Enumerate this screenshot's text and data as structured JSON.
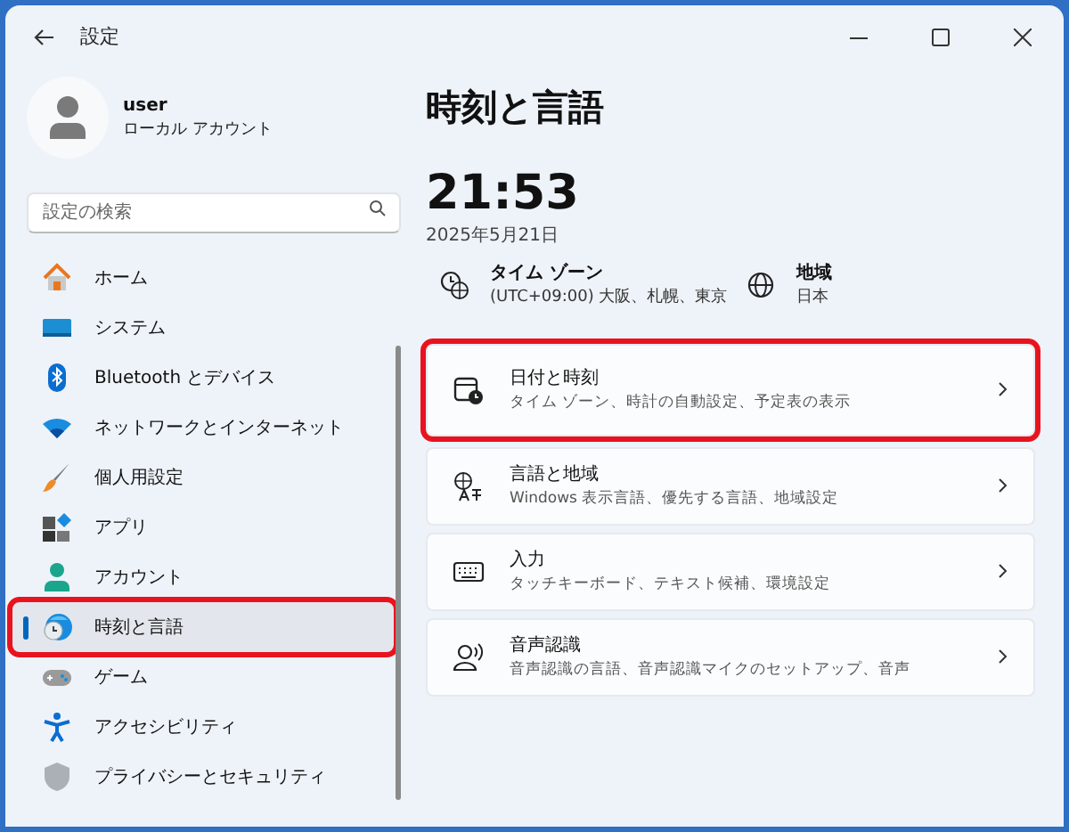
{
  "window": {
    "title": "設定"
  },
  "user": {
    "name": "user",
    "account": "ローカル アカウント"
  },
  "search": {
    "placeholder": "設定の検索"
  },
  "nav": [
    {
      "kind": "home",
      "label": "ホーム",
      "selected": false,
      "highlighted": false
    },
    {
      "kind": "system",
      "label": "システム",
      "selected": false,
      "highlighted": false
    },
    {
      "kind": "bluetooth",
      "label": "Bluetooth とデバイス",
      "selected": false,
      "highlighted": false
    },
    {
      "kind": "network",
      "label": "ネットワークとインターネット",
      "selected": false,
      "highlighted": false
    },
    {
      "kind": "brush",
      "label": "個人用設定",
      "selected": false,
      "highlighted": false
    },
    {
      "kind": "apps",
      "label": "アプリ",
      "selected": false,
      "highlighted": false
    },
    {
      "kind": "account",
      "label": "アカウント",
      "selected": false,
      "highlighted": false
    },
    {
      "kind": "time",
      "label": "時刻と言語",
      "selected": true,
      "highlighted": true
    },
    {
      "kind": "game",
      "label": "ゲーム",
      "selected": false,
      "highlighted": false
    },
    {
      "kind": "access",
      "label": "アクセシビリティ",
      "selected": false,
      "highlighted": false
    },
    {
      "kind": "privacy",
      "label": "プライバシーとセキュリティ",
      "selected": false,
      "highlighted": false
    }
  ],
  "page": {
    "title": "時刻と言語",
    "time": "21:53",
    "date": "2025年5月21日",
    "info": [
      {
        "kind": "timezone",
        "label": "タイム ゾーン",
        "value": "(UTC+09:00) 大阪、札幌、東京"
      },
      {
        "kind": "region",
        "label": "地域",
        "value": "日本"
      }
    ],
    "cards": [
      {
        "kind": "datetime",
        "title": "日付と時刻",
        "subtitle": "タイム ゾーン、時計の自動設定、予定表の表示",
        "highlighted": true
      },
      {
        "kind": "language",
        "title": "言語と地域",
        "subtitle": "Windows 表示言語、優先する言語、地域設定",
        "highlighted": false
      },
      {
        "kind": "typing",
        "title": "入力",
        "subtitle": "タッチキーボード、テキスト候補、環境設定",
        "highlighted": false
      },
      {
        "kind": "speech",
        "title": "音声認識",
        "subtitle": "音声認識の言語、音声認識マイクのセットアップ、音声",
        "highlighted": false
      }
    ]
  }
}
